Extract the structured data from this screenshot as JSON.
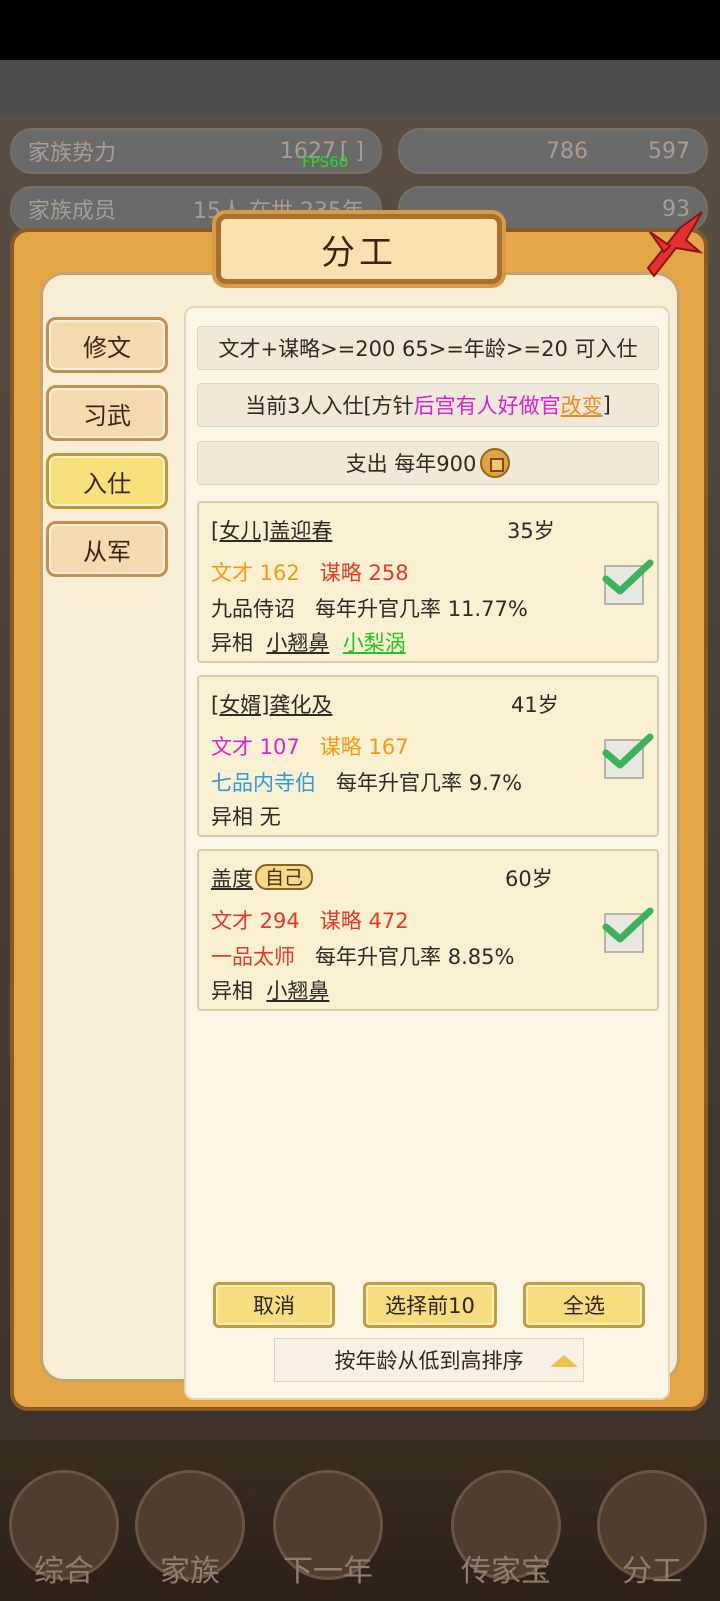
{
  "background": {
    "stats": [
      {
        "label": "家族势力",
        "value": "1627",
        "extra": "[ ]"
      },
      {
        "label": "786",
        "value": "597"
      },
      {
        "label": "家族成员",
        "value": "15人",
        "extra": "在世 235年"
      },
      {
        "label": "93",
        "value": ""
      }
    ],
    "fps": "FPS60",
    "nav": [
      "综合",
      "家族",
      "下一年",
      "传家宝",
      "分工"
    ]
  },
  "dialog": {
    "title": "分工",
    "tabs": [
      {
        "label": "修文",
        "active": false
      },
      {
        "label": "习武",
        "active": false
      },
      {
        "label": "入仕",
        "active": true
      },
      {
        "label": "从军",
        "active": false
      }
    ],
    "requirement": "文才+谋略>=200 65>=年龄>=20 可入仕",
    "current": {
      "prefix": "当前3人入仕[方针",
      "policy": "后宫有人好做官",
      "change": "改变",
      "suffix": "]"
    },
    "expense": "支出 每年900",
    "members": [
      {
        "name": "[女儿]盖迎春",
        "age": "35岁",
        "wencai": "文才 162",
        "moulue": "谋略 258",
        "rank": "九品侍诏",
        "rate": "每年升官几率 11.77%",
        "traits_label": "异相",
        "traits": [
          "小翘鼻",
          "小梨涡"
        ],
        "checked": true
      },
      {
        "name": "[女婿]龚化及",
        "age": "41岁",
        "wencai": "文才 107",
        "moulue": "谋略 167",
        "rank": "七品内寺伯",
        "rate": "每年升官几率 9.7%",
        "traits_label": "异相",
        "traits": [
          "无"
        ],
        "checked": true
      },
      {
        "name": "盖度",
        "self_tag": "自己",
        "age": "60岁",
        "wencai": "文才 294",
        "moulue": "谋略 472",
        "rank": "一品太师",
        "rate": "每年升官几率 8.85%",
        "traits_label": "异相",
        "traits": [
          "小翘鼻"
        ],
        "checked": true
      }
    ],
    "buttons": {
      "cancel": "取消",
      "select_top": "选择前10",
      "select_all": "全选"
    },
    "sort": "按年龄从低到高排序"
  }
}
